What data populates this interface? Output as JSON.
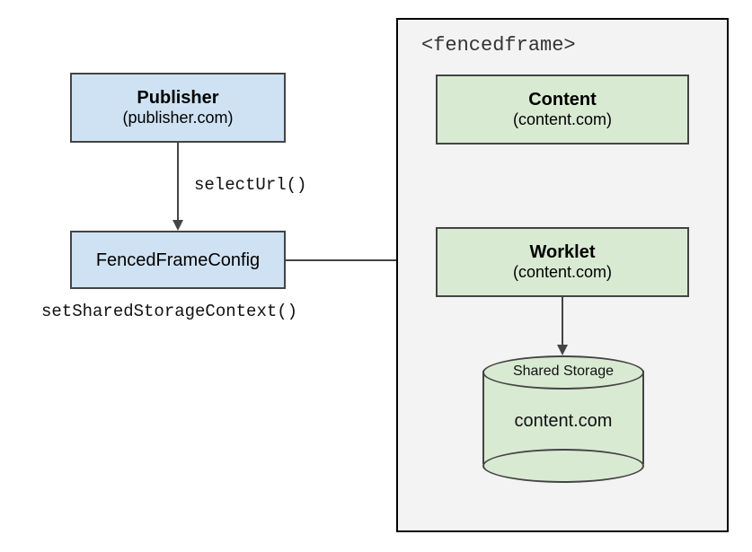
{
  "publisher": {
    "title": "Publisher",
    "subtitle": "(publisher.com)"
  },
  "fencedFrameConfig": {
    "title": "FencedFrameConfig"
  },
  "arrowLabel1": "selectUrl()",
  "methodBelow": "setSharedStorageContext()",
  "frame": {
    "label": "<fencedframe>"
  },
  "content": {
    "title": "Content",
    "subtitle": "(content.com)"
  },
  "worklet": {
    "title": "Worklet",
    "subtitle": "(content.com)"
  },
  "storage": {
    "label": "Shared Storage",
    "domain": "content.com"
  }
}
